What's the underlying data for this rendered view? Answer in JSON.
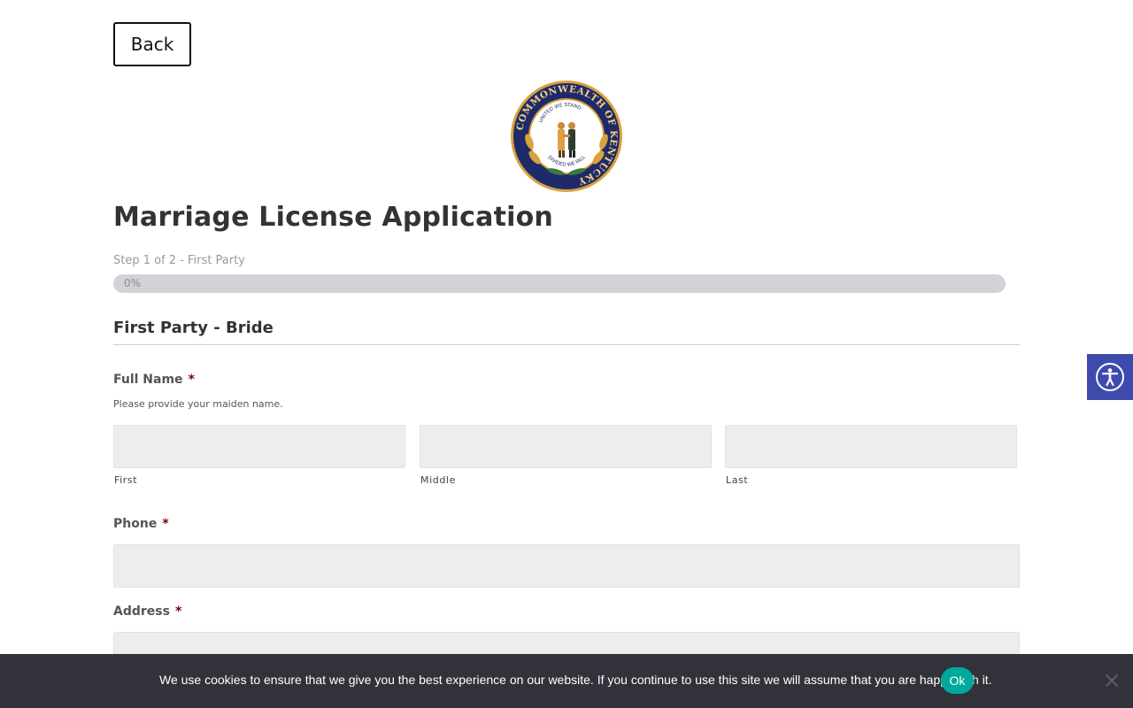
{
  "nav": {
    "back_label": "Back"
  },
  "seal": {
    "name": "kentucky-state-seal",
    "ring_text": "COMMONWEALTH OF KENTUCKY",
    "top_text": "UNITED WE STAND",
    "bottom_text": "DIVIDED WE FALL",
    "colors": {
      "ring": "#1f2a6b",
      "gold": "#d9a23c",
      "center": "#ffffff"
    }
  },
  "page": {
    "title": "Marriage License Application",
    "step_text": "Step 1 of 2 - First Party",
    "progress_label": "0%",
    "progress_value": 0
  },
  "section": {
    "title": "First Party - Bride"
  },
  "fields": {
    "full_name": {
      "label": "Full Name",
      "required_mark": "*",
      "description": "Please provide your maiden name.",
      "sub": {
        "first": "First",
        "middle": "Middle",
        "last": "Last"
      },
      "values": {
        "first": "",
        "middle": "",
        "last": ""
      }
    },
    "phone": {
      "label": "Phone",
      "required_mark": "*",
      "value": ""
    },
    "address": {
      "label": "Address",
      "required_mark": "*",
      "value": ""
    }
  },
  "accessibility": {
    "icon": "accessibility-icon",
    "color": "#3e4bad"
  },
  "cookie": {
    "text": "We use cookies to ensure that we give you the best experience on our website. If you continue to use this site we will assume that you are happy with it.",
    "ok_label": "Ok",
    "ok_color": "#00a99d",
    "background": "#32323a"
  }
}
